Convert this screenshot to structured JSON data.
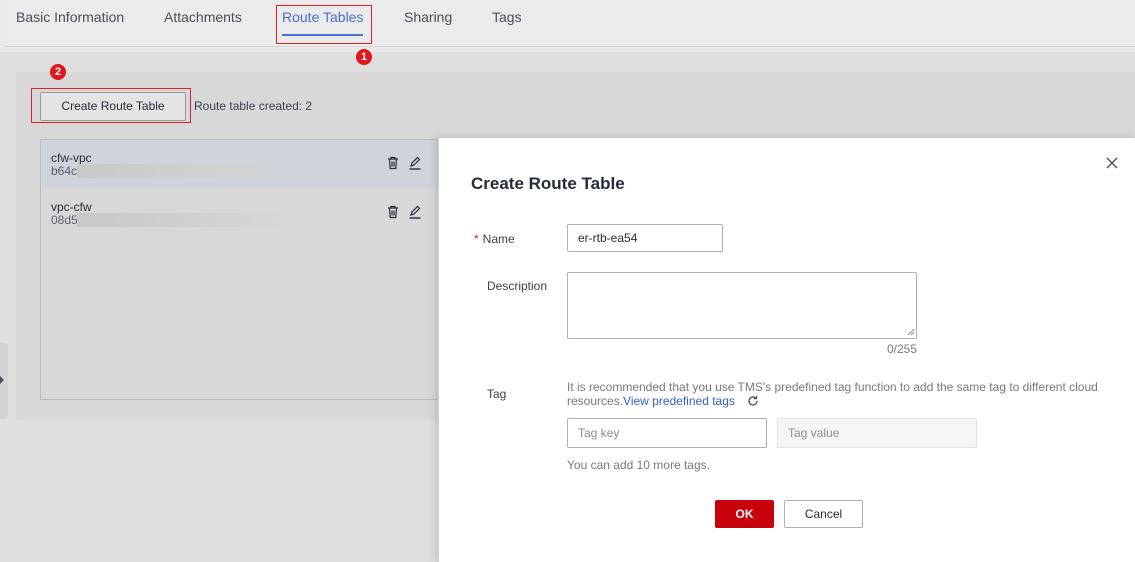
{
  "tabs": [
    {
      "label": "Basic Information"
    },
    {
      "label": "Attachments"
    },
    {
      "label": "Route Tables",
      "active": true
    },
    {
      "label": "Sharing"
    },
    {
      "label": "Tags"
    }
  ],
  "annotations": {
    "step1": "1",
    "step2": "2"
  },
  "toolbar": {
    "create_label": "Create Route Table",
    "created_text": "Route table created: 2"
  },
  "route_tables": [
    {
      "name": "cfw-vpc",
      "id_prefix": "b64c",
      "selected": true
    },
    {
      "name": "vpc-cfw",
      "id_prefix": "08d5",
      "selected": false
    }
  ],
  "icons": {
    "delete": "trash-icon",
    "edit": "pencil-icon",
    "close": "close-icon",
    "refresh": "refresh-icon",
    "collapse": "chevron-right-icon"
  },
  "modal": {
    "title": "Create Route Table",
    "name_label": "Name",
    "required_mark": "*",
    "name_value": "er-rtb-ea54",
    "description_label": "Description",
    "description_value": "",
    "description_counter": "0/255",
    "tag_label": "Tag",
    "tag_hint": "It is recommended that you use TMS's predefined tag function to add the same tag to different cloud resources.",
    "tag_link": "View predefined tags",
    "tag_key_placeholder": "Tag key",
    "tag_value_placeholder": "Tag value",
    "more_tags": "You can add 10 more tags.",
    "ok_label": "OK",
    "cancel_label": "Cancel"
  },
  "colors": {
    "accent": "#4a6fd0",
    "primary_button": "#c7000b",
    "link": "#3560c5",
    "annotation": "#e0161b"
  }
}
